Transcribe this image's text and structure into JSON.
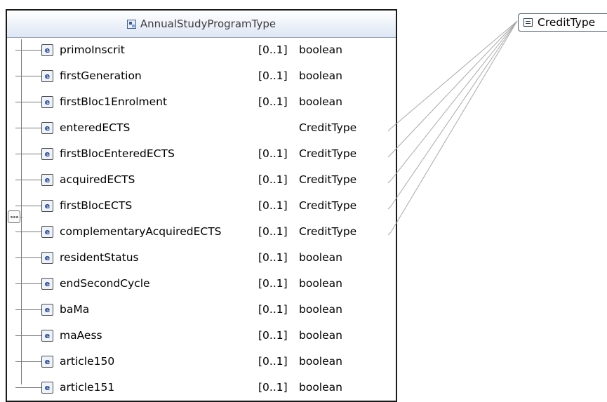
{
  "complex_type": {
    "title": "AnnualStudyProgramType",
    "icon": "complex-type-icon",
    "compositor_icon": "sequence-icon",
    "element_badge": "e",
    "elements": [
      {
        "name": "primoInscrit",
        "cardinality": "[0..1]",
        "type": "boolean"
      },
      {
        "name": "firstGeneration",
        "cardinality": "[0..1]",
        "type": "boolean"
      },
      {
        "name": "firstBloc1Enrolment",
        "cardinality": "[0..1]",
        "type": "boolean"
      },
      {
        "name": "enteredECTS",
        "cardinality": "",
        "type": "CreditType"
      },
      {
        "name": "firstBlocEnteredECTS",
        "cardinality": "[0..1]",
        "type": "CreditType"
      },
      {
        "name": "acquiredECTS",
        "cardinality": "[0..1]",
        "type": "CreditType"
      },
      {
        "name": "firstBlocECTS",
        "cardinality": "[0..1]",
        "type": "CreditType"
      },
      {
        "name": "complementaryAcquiredECTS",
        "cardinality": "[0..1]",
        "type": "CreditType"
      },
      {
        "name": "residentStatus",
        "cardinality": "[0..1]",
        "type": "boolean"
      },
      {
        "name": "endSecondCycle",
        "cardinality": "[0..1]",
        "type": "boolean"
      },
      {
        "name": "baMa",
        "cardinality": "[0..1]",
        "type": "boolean"
      },
      {
        "name": "maAess",
        "cardinality": "[0..1]",
        "type": "boolean"
      },
      {
        "name": "article150",
        "cardinality": "[0..1]",
        "type": "boolean"
      },
      {
        "name": "article151",
        "cardinality": "[0..1]",
        "type": "boolean"
      }
    ]
  },
  "referenced_type": {
    "label": "CreditType",
    "icon": "simple-type-list-icon"
  },
  "colors": {
    "header_gradient_bottom": "#dde6f4",
    "element_badge_text": "#1a3f8a",
    "link_line": "#a9a9a9",
    "box_border": "#1a1a1a"
  }
}
